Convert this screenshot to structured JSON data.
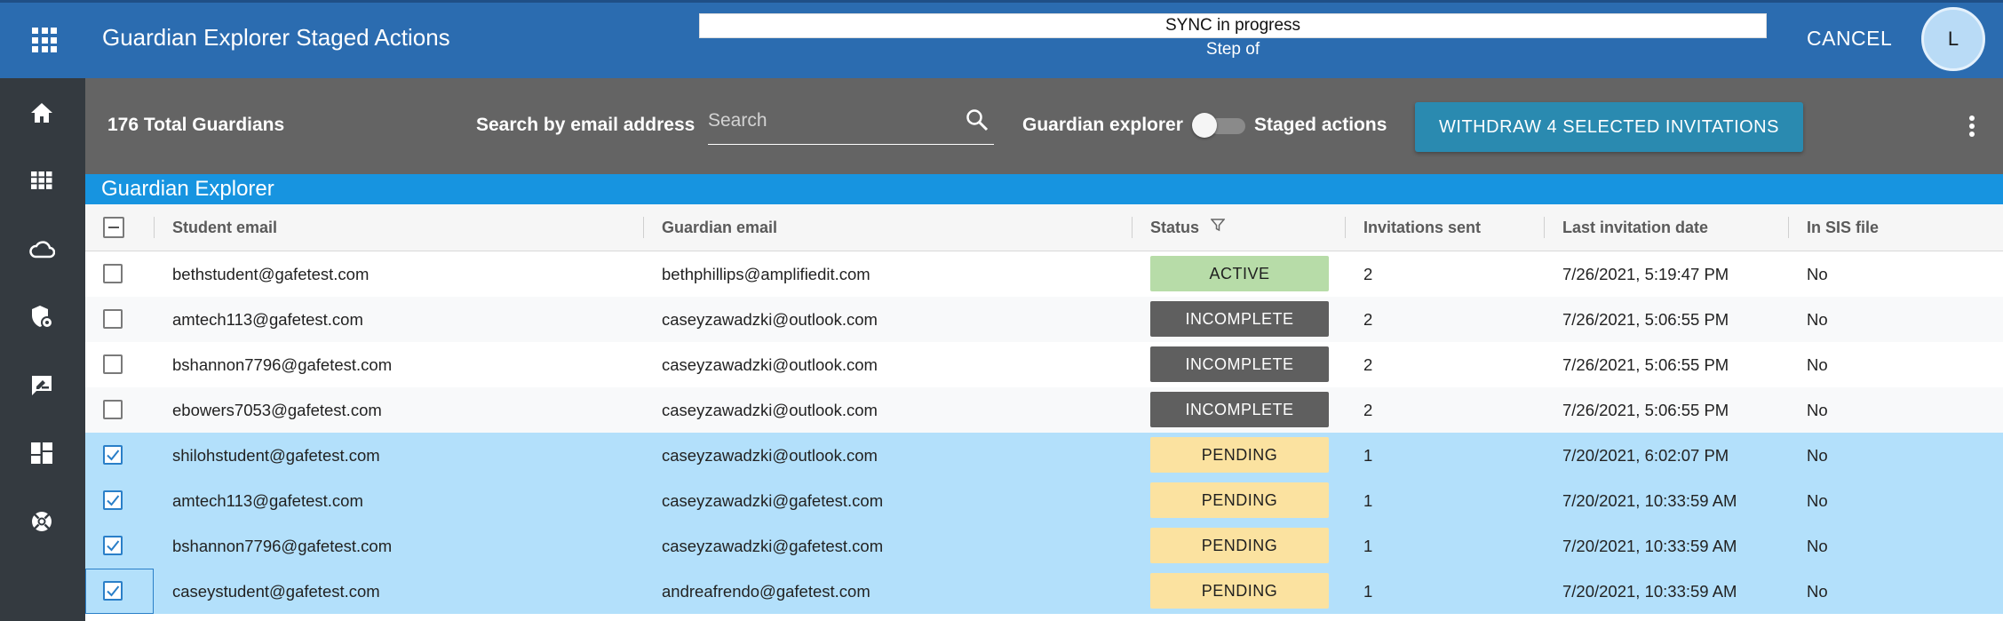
{
  "header": {
    "title": "Guardian Explorer Staged Actions",
    "sync_status": "SYNC in progress",
    "sync_step": "Step of",
    "cancel_label": "CANCEL",
    "avatar_initial": "L"
  },
  "sidebar": {
    "items": [
      {
        "icon": "home-icon"
      },
      {
        "icon": "grid-icon"
      },
      {
        "icon": "cloud-icon"
      },
      {
        "icon": "shield-gear-icon"
      },
      {
        "icon": "message-icon"
      },
      {
        "icon": "dashboard-icon"
      },
      {
        "icon": "support-icon"
      }
    ]
  },
  "toolbar": {
    "total": "176 Total Guardians",
    "search_label": "Search by email address",
    "search_placeholder": "Search",
    "search_value": "",
    "toggle_left": "Guardian explorer",
    "toggle_right": "Staged actions",
    "toggle_on": false,
    "withdraw_label": "WITHDRAW 4 SELECTED INVITATIONS"
  },
  "section_title": "Guardian Explorer",
  "colors": {
    "topbar": "#2b6cb0",
    "sidebar": "#343a40",
    "toolbar": "#646464",
    "section": "#1794e0",
    "selected_row": "#b3e0fb",
    "active": "#b7dca8",
    "incomplete": "#5f5f5f",
    "pending": "#fbe2a0"
  },
  "table": {
    "columns": {
      "student": "Student email",
      "guardian": "Guardian email",
      "status": "Status",
      "invitations": "Invitations sent",
      "last": "Last invitation date",
      "sis": "In SIS file"
    },
    "rows": [
      {
        "checked": false,
        "student": "bethstudent@gafetest.com",
        "guardian": "bethphillips@amplifiedit.com",
        "status": "ACTIVE",
        "invitations": "2",
        "last": "7/26/2021, 5:19:47 PM",
        "sis": "No"
      },
      {
        "checked": false,
        "student": "amtech113@gafetest.com",
        "guardian": "caseyzawadzki@outlook.com",
        "status": "INCOMPLETE",
        "invitations": "2",
        "last": "7/26/2021, 5:06:55 PM",
        "sis": "No"
      },
      {
        "checked": false,
        "student": "bshannon7796@gafetest.com",
        "guardian": "caseyzawadzki@outlook.com",
        "status": "INCOMPLETE",
        "invitations": "2",
        "last": "7/26/2021, 5:06:55 PM",
        "sis": "No"
      },
      {
        "checked": false,
        "student": "ebowers7053@gafetest.com",
        "guardian": "caseyzawadzki@outlook.com",
        "status": "INCOMPLETE",
        "invitations": "2",
        "last": "7/26/2021, 5:06:55 PM",
        "sis": "No"
      },
      {
        "checked": true,
        "student": "shilohstudent@gafetest.com",
        "guardian": "caseyzawadzki@outlook.com",
        "status": "PENDING",
        "invitations": "1",
        "last": "7/20/2021, 6:02:07 PM",
        "sis": "No"
      },
      {
        "checked": true,
        "student": "amtech113@gafetest.com",
        "guardian": "caseyzawadzki@gafetest.com",
        "status": "PENDING",
        "invitations": "1",
        "last": "7/20/2021, 10:33:59 AM",
        "sis": "No"
      },
      {
        "checked": true,
        "student": "bshannon7796@gafetest.com",
        "guardian": "caseyzawadzki@gafetest.com",
        "status": "PENDING",
        "invitations": "1",
        "last": "7/20/2021, 10:33:59 AM",
        "sis": "No"
      },
      {
        "checked": true,
        "student": "caseystudent@gafetest.com",
        "guardian": "andreafrendo@gafetest.com",
        "status": "PENDING",
        "invitations": "1",
        "last": "7/20/2021, 10:33:59 AM",
        "sis": "No"
      }
    ]
  }
}
